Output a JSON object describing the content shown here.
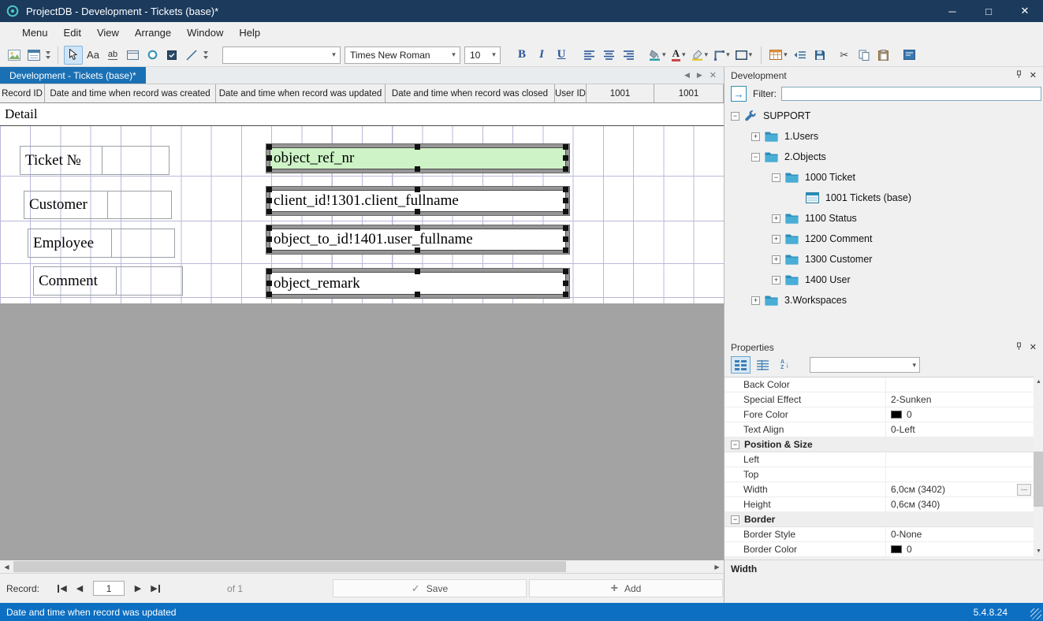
{
  "window": {
    "title": "ProjectDB - Development - Tickets (base)*"
  },
  "menubar": {
    "items": [
      "Menu",
      "Edit",
      "View",
      "Arrange",
      "Window",
      "Help"
    ]
  },
  "toolbar": {
    "label_tool": "Aa",
    "textbox_tool": "ab",
    "style_combo_value": "",
    "font_name": "Times New Roman",
    "font_size": "10",
    "bold": "B",
    "italic": "I",
    "underline": "U"
  },
  "tabstrip": {
    "active_tab": "Development - Tickets (base)*"
  },
  "form_header": {
    "columns": [
      "Record ID",
      "Date and time when record was created",
      "Date and time when record was updated",
      "Date and time when record was closed",
      "User ID",
      "1001",
      "1001"
    ]
  },
  "designer": {
    "band_label": "Detail",
    "rows": [
      {
        "label": "Ticket №",
        "field": "object_ref_nr",
        "selected_color": "#cdf3c6"
      },
      {
        "label": "Customer",
        "field": "client_id!1301.client_fullname"
      },
      {
        "label": "Employee",
        "field": "object_to_id!1401.user_fullname"
      },
      {
        "label": "Comment",
        "field": "object_remark"
      }
    ]
  },
  "record_nav": {
    "label": "Record:",
    "current": "1",
    "of": "of 1",
    "save_label": "Save",
    "add_label": "Add"
  },
  "development_panel": {
    "title": "Development",
    "filter_label": "Filter:",
    "filter_value": "",
    "tree": [
      {
        "label": "SUPPORT",
        "level": 0,
        "expander": "-",
        "icon": "wrench"
      },
      {
        "label": "1.Users",
        "level": 1,
        "expander": "+",
        "icon": "folder"
      },
      {
        "label": "2.Objects",
        "level": 1,
        "expander": "-",
        "icon": "folder"
      },
      {
        "label": "1000 Ticket",
        "level": 2,
        "expander": "-",
        "icon": "folder"
      },
      {
        "label": "1001 Tickets (base)",
        "level": 3,
        "expander": "",
        "icon": "form"
      },
      {
        "label": "1100 Status",
        "level": 2,
        "expander": "+",
        "icon": "folder"
      },
      {
        "label": "1200 Comment",
        "level": 2,
        "expander": "+",
        "icon": "folder"
      },
      {
        "label": "1300 Customer",
        "level": 2,
        "expander": "+",
        "icon": "folder"
      },
      {
        "label": "1400 User",
        "level": 2,
        "expander": "+",
        "icon": "folder"
      },
      {
        "label": "3.Workspaces",
        "level": 1,
        "expander": "+",
        "icon": "folder"
      }
    ]
  },
  "properties_panel": {
    "title": "Properties",
    "combo_value": "",
    "rows": [
      {
        "type": "prop",
        "name": "Back Color",
        "value": ""
      },
      {
        "type": "prop",
        "name": "Special Effect",
        "value": "2-Sunken"
      },
      {
        "type": "prop",
        "name": "Fore Color",
        "value": "0",
        "swatch": "#000000"
      },
      {
        "type": "prop",
        "name": "Text Align",
        "value": "0-Left"
      },
      {
        "type": "group",
        "name": "Position & Size"
      },
      {
        "type": "prop",
        "name": "Left",
        "value": ""
      },
      {
        "type": "prop",
        "name": "Top",
        "value": ""
      },
      {
        "type": "prop",
        "name": "Width",
        "value": "6,0см (3402)",
        "ellipsis": true
      },
      {
        "type": "prop",
        "name": "Height",
        "value": "0,6см (340)"
      },
      {
        "type": "group",
        "name": "Border"
      },
      {
        "type": "prop",
        "name": "Border Style",
        "value": "0-None"
      },
      {
        "type": "prop",
        "name": "Border Color",
        "value": "0",
        "swatch": "#000000"
      }
    ],
    "footer": "Width"
  },
  "status_bar": {
    "left": "Date and time when record was updated",
    "right": "5.4.8.24"
  },
  "colors": {
    "titlebar": "#1b3a5c",
    "active_tab": "#1a70b4",
    "statusbar": "#0d6fc2",
    "selected_field": "#cdf3c6",
    "grid_line": "#b9b9da"
  },
  "icons": {
    "minimize": "─",
    "maximize": "□",
    "close": "✕",
    "tab_scroll_left": "◀",
    "tab_scroll_right": "▶",
    "tab_close": "✕",
    "panel_close": "✕",
    "dropdown": "▾",
    "nav_first": "◀",
    "nav_prev": "◀",
    "nav_next": "▶",
    "nav_last": "▶",
    "scroll_left": "◀",
    "scroll_right": "▶",
    "scroll_up": "▲",
    "scroll_down": "▼",
    "check": "✓",
    "plus": "+",
    "ellipsis": "...",
    "expand": "+",
    "collapse": "−",
    "filter_go": "→"
  }
}
